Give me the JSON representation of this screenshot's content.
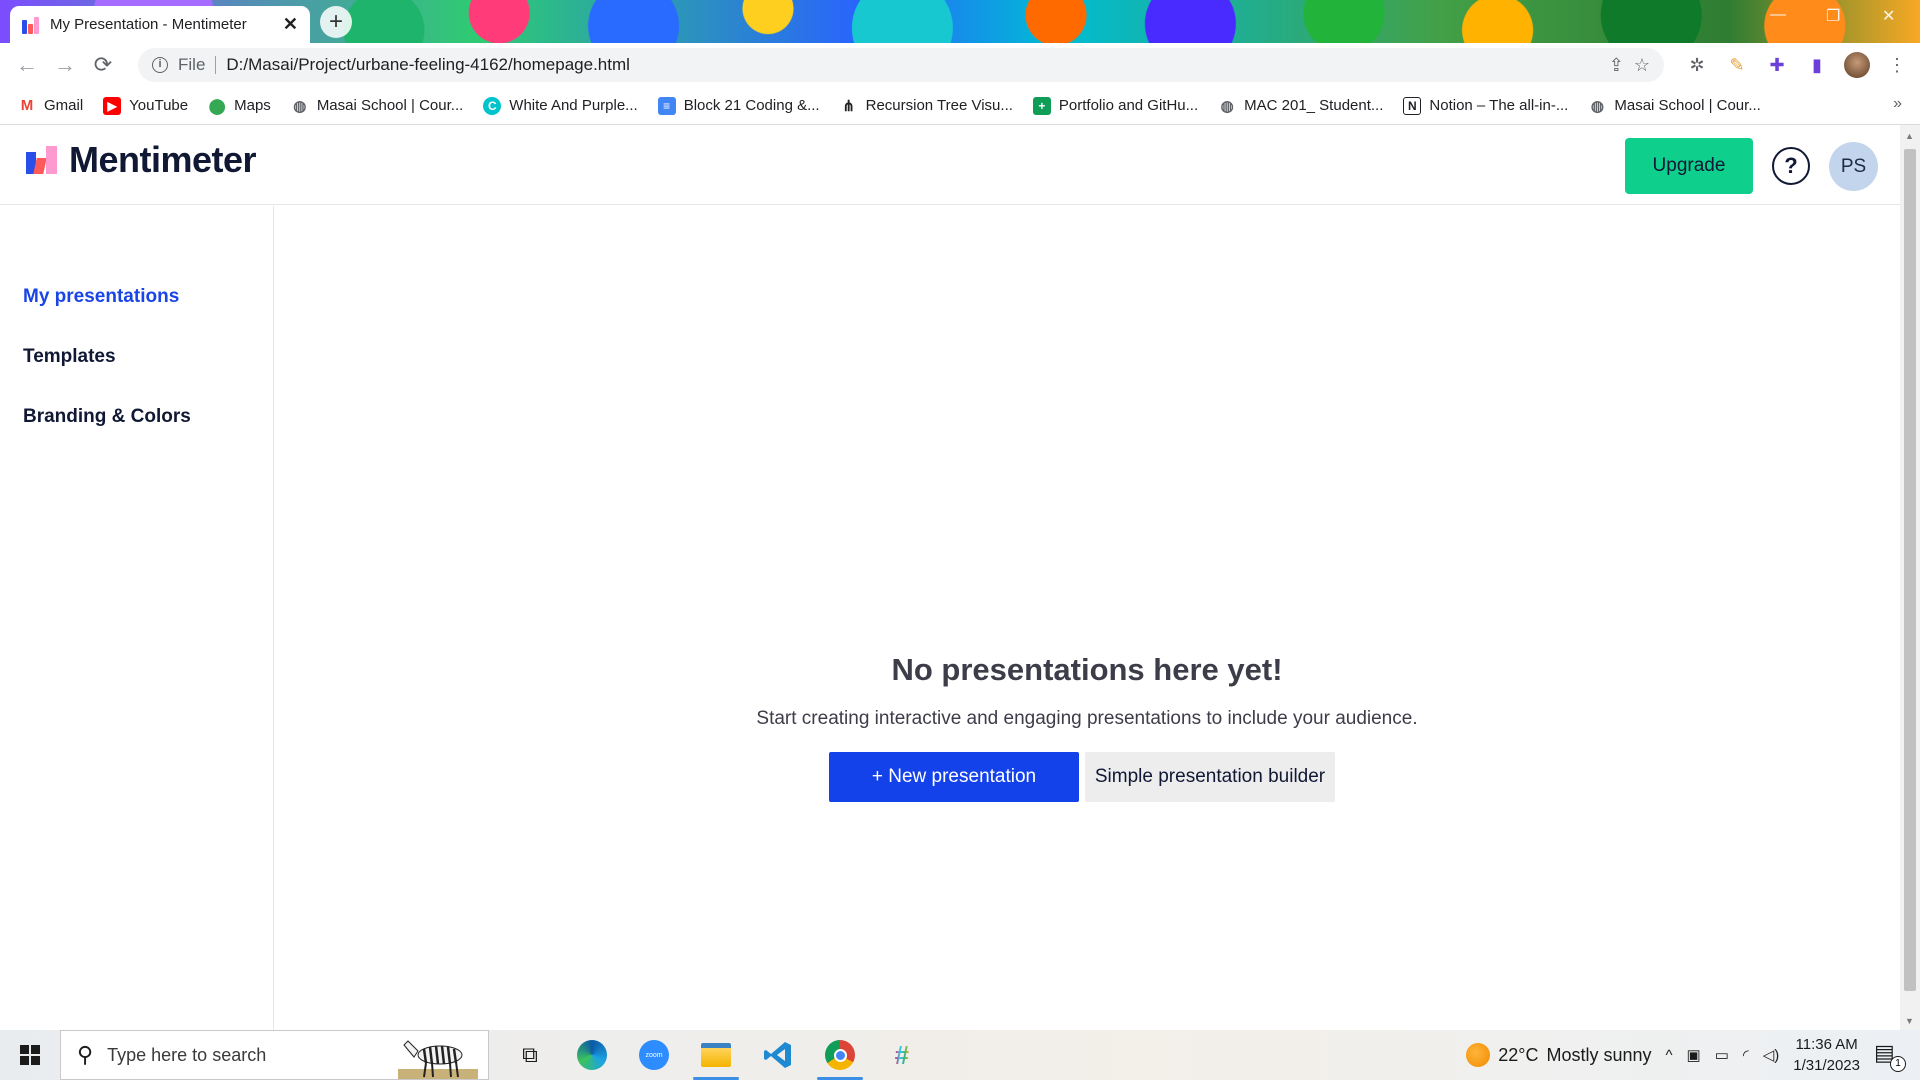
{
  "browser": {
    "tab_title": "My Presentation - Mentimeter",
    "tab_close": "✕",
    "new_tab": "+",
    "scheme_label": "File",
    "url": "D:/Masai/Project/urbane-feeling-4162/homepage.html",
    "bookmarks": [
      {
        "label": "Gmail",
        "icon": "gmail-icon",
        "color": "#ea4335"
      },
      {
        "label": "YouTube",
        "icon": "youtube-icon",
        "color": "#ff0000"
      },
      {
        "label": "Maps",
        "icon": "maps-pin-icon",
        "color": "#34a853"
      },
      {
        "label": "Masai School | Cour...",
        "icon": "globe-icon",
        "color": "#5f6368"
      },
      {
        "label": "White And Purple...",
        "icon": "canva-icon",
        "color": "#00c4cc"
      },
      {
        "label": "Block 21 Coding &...",
        "icon": "docs-icon",
        "color": "#4285f4"
      },
      {
        "label": "Recursion Tree Visu...",
        "icon": "tree-icon",
        "color": "#202124"
      },
      {
        "label": "Portfolio and GitHu...",
        "icon": "sheets-icon",
        "color": "#0f9d58"
      },
      {
        "label": "MAC 201_ Student...",
        "icon": "globe-icon",
        "color": "#5f6368"
      },
      {
        "label": "Notion – The all-in-...",
        "icon": "notion-icon",
        "color": "#202124"
      },
      {
        "label": "Masai School | Cour...",
        "icon": "globe-icon",
        "color": "#5f6368"
      }
    ],
    "bookmarks_more": "»"
  },
  "app": {
    "brand": "Mentimeter",
    "upgrade_label": "Upgrade",
    "help_label": "?",
    "avatar_initials": "PS",
    "accent_color": "#1442ea",
    "upgrade_color": "#0ecf8c",
    "sidebar": [
      {
        "label": "My presentations",
        "active": true
      },
      {
        "label": "Templates",
        "active": false
      },
      {
        "label": "Branding & Colors",
        "active": false
      }
    ],
    "empty_state": {
      "title": "No presentations here yet!",
      "subtitle": "Start creating interactive and engaging presentations to include your audience.",
      "primary_button": "+ New presentation",
      "secondary_button": "Simple presentation builder"
    }
  },
  "taskbar": {
    "search_placeholder": "Type here to search",
    "weather_temp": "22°C",
    "weather_text": "Mostly sunny",
    "time": "11:36 AM",
    "date": "1/31/2023",
    "notification_count": "1",
    "pinned": [
      "task-view-icon",
      "edge-icon",
      "zoom-icon",
      "file-explorer-icon",
      "vscode-icon",
      "chrome-icon",
      "slack-icon"
    ]
  }
}
